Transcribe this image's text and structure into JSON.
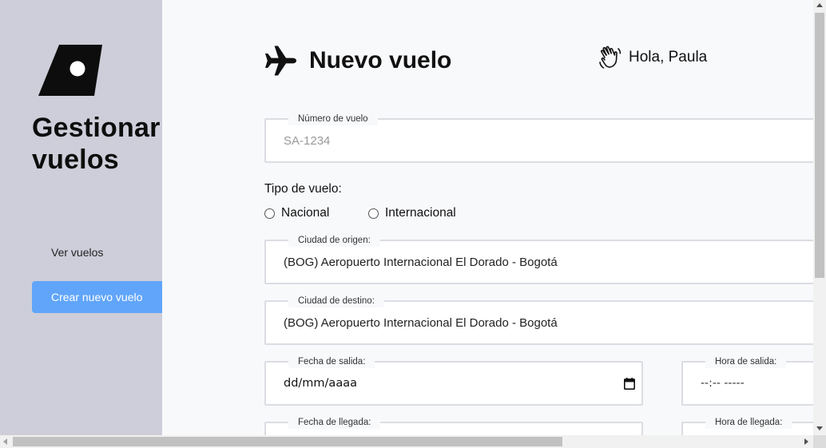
{
  "sidebar": {
    "logo_icon": "tail-fin-logo-icon",
    "title": "Gestionar vuelos",
    "items": [
      {
        "label": "Ver vuelos",
        "active": false
      },
      {
        "label": "Crear nuevo vuelo",
        "active": true
      }
    ],
    "active_color": "#60a5fa",
    "background": "#cdced9"
  },
  "header": {
    "icon": "airplane-icon",
    "title": "Nuevo vuelo",
    "greeting_icon": "waving-hand-icon",
    "greeting": "Hola, Paula"
  },
  "form": {
    "numero": {
      "label": "Número de vuelo",
      "placeholder": "SA-1234",
      "value": ""
    },
    "tipo": {
      "label": "Tipo de vuelo:",
      "options": [
        {
          "label": "Nacional",
          "checked": false
        },
        {
          "label": "Internacional",
          "checked": false
        }
      ]
    },
    "origen": {
      "label": "Ciudad de origen:",
      "value": "(BOG) Aeropuerto Internacional El Dorado - Bogotá"
    },
    "destino": {
      "label": "Ciudad de destino:",
      "value": "(BOG) Aeropuerto Internacional El Dorado - Bogotá"
    },
    "fecha_salida": {
      "label": "Fecha de salida:",
      "value": "dd/mm/aaaa",
      "icon": "calendar-icon"
    },
    "hora_salida": {
      "label": "Hora de salida:",
      "value": "--:-- -----"
    },
    "fecha_llegada": {
      "label": "Fecha de llegada:"
    },
    "hora_llegada": {
      "label": "Hora de llegada:"
    }
  }
}
